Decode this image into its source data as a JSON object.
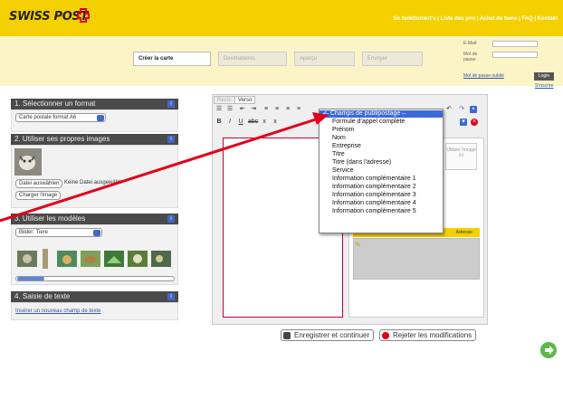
{
  "header": {
    "logo_text": "SWISS POST",
    "links": "So funktioniert's | Liste des prix | Achat de bons | FAQ | Kontakt"
  },
  "steps": [
    "Créer la carte",
    "Destinataires",
    "Aperçu",
    "Envoyer"
  ],
  "login": {
    "email_label": "E-Mail:",
    "password_label": "Mot de passe:",
    "forgot": "Mot de passe oublié",
    "login_button": "Login",
    "register": "S'inscrire"
  },
  "panel1": {
    "title": "1. Sélectionner un format",
    "format_value": "Carte postale format A6"
  },
  "panel2": {
    "title": "2. Utiliser ses propres images",
    "choose_file": "Datei auswählen",
    "no_file": "Keine Datei ausgewählt",
    "upload": "Charger l'image"
  },
  "panel3": {
    "title": "3. Utiliser les modèles",
    "category_value": "Bilder: Tiere"
  },
  "panel4": {
    "title": "4. Saisie de texte",
    "add_text_link": "Insérer un nouveau champ de texte"
  },
  "editor": {
    "tab_recto": "Recto",
    "tab_verso": "Verso",
    "photo_placeholder": "Utiliser l'image ici",
    "address_label": "Adresse"
  },
  "dropdown": {
    "items": [
      "– Champs de publipostage –",
      "Formule d'appel complète",
      "Prénom",
      "Nom",
      "Entreprise",
      "Titre",
      "Titre (dans l'adresse)",
      "Service",
      "Information complémentaire 1",
      "Information complémentaire 2",
      "Information complémentaire 3",
      "Information complémentaire 4",
      "Information complémentaire 5"
    ]
  },
  "bottom": {
    "save": "Enregistrer et continuer",
    "reject": "Rejeter les modifications"
  },
  "colors": {
    "brand_yellow": "#f5d000",
    "accent_blue": "#3a6ad8",
    "red": "#e2001a"
  }
}
